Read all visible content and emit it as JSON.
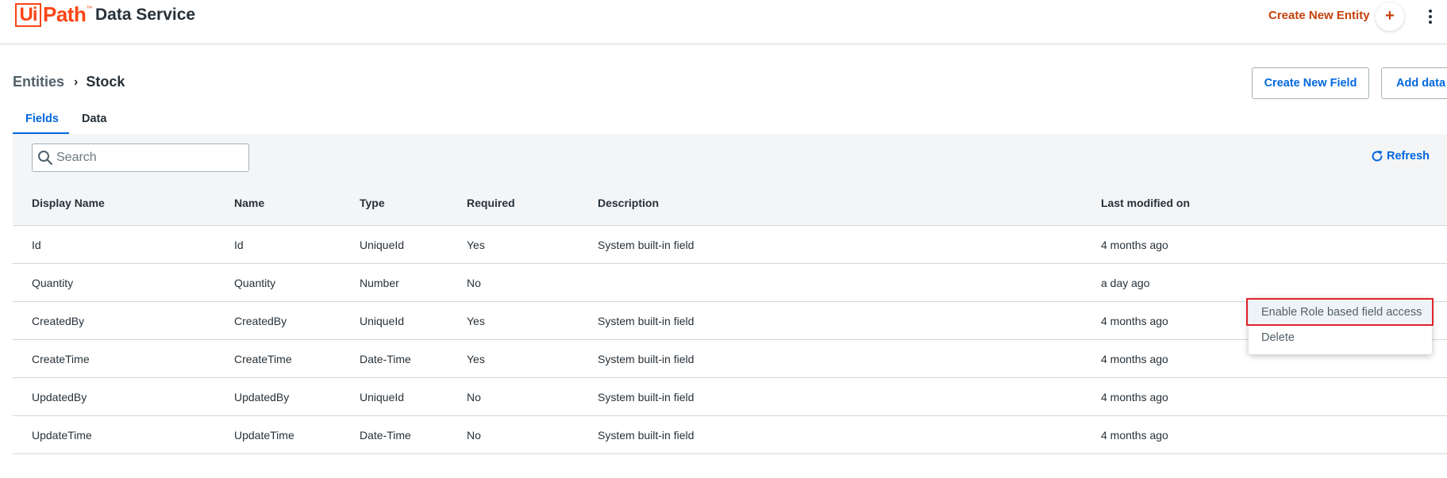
{
  "header": {
    "logo_box": "Ui",
    "logo_path": "Path",
    "logo_tm": "™",
    "app_name": "Data Service",
    "create_entity": "Create New Entity",
    "plus": "+"
  },
  "breadcrumb": {
    "entities": "Entities",
    "separator": "›",
    "current": "Stock"
  },
  "actions": {
    "create_field": "Create New Field",
    "add_data": "Add data"
  },
  "tabs": [
    {
      "label": "Fields",
      "active": true
    },
    {
      "label": "Data",
      "active": false
    }
  ],
  "toolbar": {
    "search_placeholder": "Search",
    "refresh": "Refresh"
  },
  "table": {
    "headers": [
      "Display Name",
      "Name",
      "Type",
      "Required",
      "Description",
      "Last modified on"
    ],
    "rows": [
      [
        "Id",
        "Id",
        "UniqueId",
        "Yes",
        "System built-in field",
        "4 months ago"
      ],
      [
        "Quantity",
        "Quantity",
        "Number",
        "No",
        "",
        "a day ago"
      ],
      [
        "CreatedBy",
        "CreatedBy",
        "UniqueId",
        "Yes",
        "System built-in field",
        "4 months ago"
      ],
      [
        "CreateTime",
        "CreateTime",
        "Date-Time",
        "Yes",
        "System built-in field",
        "4 months ago"
      ],
      [
        "UpdatedBy",
        "UpdatedBy",
        "UniqueId",
        "No",
        "System built-in field",
        "4 months ago"
      ],
      [
        "UpdateTime",
        "UpdateTime",
        "Date-Time",
        "No",
        "System built-in field",
        "4 months ago"
      ]
    ]
  },
  "context_menu": {
    "items": [
      "Enable Role based field access",
      "Delete"
    ]
  },
  "colors": {
    "brand_orange": "#fa4616",
    "accent_blue": "#0067df",
    "highlight_red": "#e0242a"
  }
}
